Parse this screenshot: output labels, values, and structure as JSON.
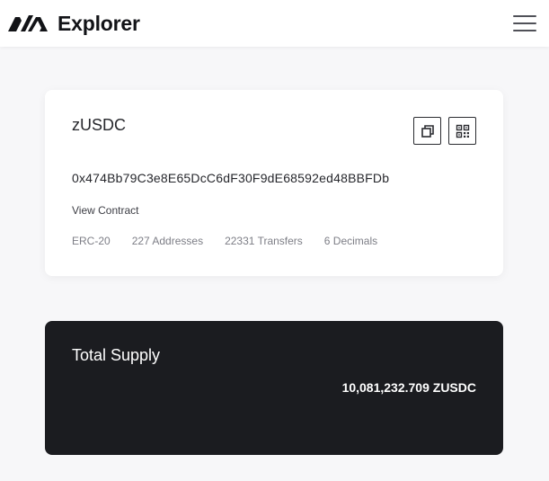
{
  "header": {
    "title": "Explorer",
    "logo_icon": "avalanche-logo-icon",
    "menu_icon": "hamburger-menu-icon"
  },
  "token": {
    "name": "zUSDC",
    "address": "0x474Bb79C3e8E65DcC6dF30F9dE68592ed48BBFDb",
    "view_contract_label": "View Contract",
    "meta": [
      "ERC-20",
      "227 Addresses",
      "22331 Transfers",
      "6 Decimals"
    ],
    "actions": [
      "copy-icon",
      "qr-code-icon"
    ]
  },
  "supply": {
    "title": "Total Supply",
    "value": "10,081,232.709 ZUSDC"
  },
  "colors": {
    "background": "#f7f7f9",
    "card": "#ffffff",
    "dark_card": "#1b1c20",
    "text": "#26272c",
    "muted": "#7d7e86"
  }
}
